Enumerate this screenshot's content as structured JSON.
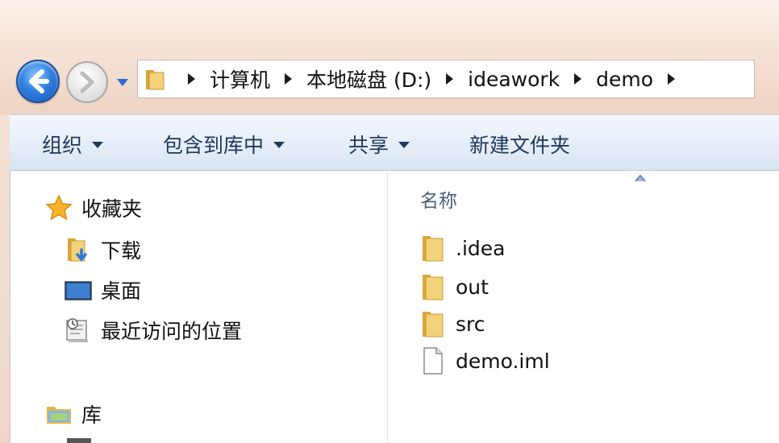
{
  "address": {
    "crumbs": [
      "计算机",
      "本地磁盘 (D:)",
      "ideawork",
      "demo"
    ]
  },
  "toolbar": {
    "organize": "组织",
    "include_in_library": "包含到库中",
    "share": "共享",
    "new_folder": "新建文件夹"
  },
  "nav": {
    "favorites": "收藏夹",
    "downloads": "下载",
    "desktop": "桌面",
    "recent_places": "最近访问的位置",
    "libraries": "库"
  },
  "files": {
    "column_name": "名称",
    "items": [
      ".idea",
      "out",
      "src",
      "demo.iml"
    ]
  },
  "colors": {
    "toolbar_text": "#1e395b",
    "folder_yellow": "#e9b949",
    "back_button_blue": "#2f7fe0"
  }
}
